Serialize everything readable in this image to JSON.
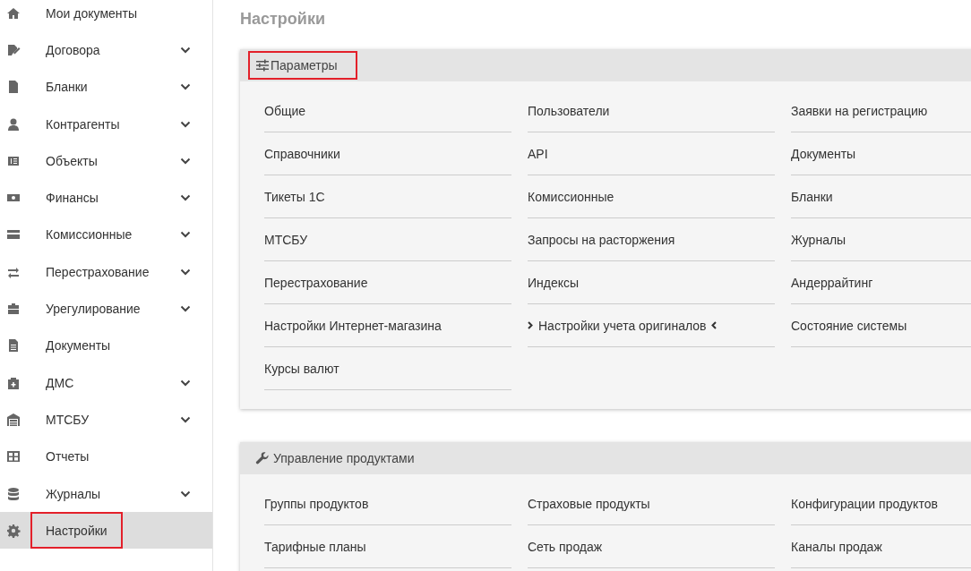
{
  "sidebar": {
    "items": [
      {
        "label": "Мои документы",
        "expandable": false,
        "selected": false,
        "highlighted": false
      },
      {
        "label": "Договора",
        "expandable": true,
        "selected": false,
        "highlighted": false
      },
      {
        "label": "Бланки",
        "expandable": true,
        "selected": false,
        "highlighted": false
      },
      {
        "label": "Контрагенты",
        "expandable": true,
        "selected": false,
        "highlighted": false
      },
      {
        "label": "Объекты",
        "expandable": true,
        "selected": false,
        "highlighted": false
      },
      {
        "label": "Финансы",
        "expandable": true,
        "selected": false,
        "highlighted": false
      },
      {
        "label": "Комиссионные",
        "expandable": true,
        "selected": false,
        "highlighted": false
      },
      {
        "label": "Перестрахование",
        "expandable": true,
        "selected": false,
        "highlighted": false
      },
      {
        "label": "Урегулирование",
        "expandable": true,
        "selected": false,
        "highlighted": false
      },
      {
        "label": "Документы",
        "expandable": false,
        "selected": false,
        "highlighted": false
      },
      {
        "label": "ДМС",
        "expandable": true,
        "selected": false,
        "highlighted": false
      },
      {
        "label": "МТСБУ",
        "expandable": true,
        "selected": false,
        "highlighted": false
      },
      {
        "label": "Отчеты",
        "expandable": false,
        "selected": false,
        "highlighted": false
      },
      {
        "label": "Журналы",
        "expandable": true,
        "selected": false,
        "highlighted": false
      },
      {
        "label": "Настройки",
        "expandable": false,
        "selected": true,
        "highlighted": true
      }
    ]
  },
  "page_title": "Настройки",
  "cards": [
    {
      "title": "Параметры",
      "highlighted": true,
      "links": [
        {
          "label": "Общие",
          "hovered": false
        },
        {
          "label": "Пользователи",
          "hovered": false
        },
        {
          "label": "Заявки на регистрацию",
          "hovered": false
        },
        {
          "label": "Справочники",
          "hovered": false
        },
        {
          "label": "API",
          "hovered": false
        },
        {
          "label": "Документы",
          "hovered": false
        },
        {
          "label": "Тикеты 1С",
          "hovered": false
        },
        {
          "label": "Комиссионные",
          "hovered": false
        },
        {
          "label": "Бланки",
          "hovered": false
        },
        {
          "label": "МТСБУ",
          "hovered": false
        },
        {
          "label": "Запросы на расторжения",
          "hovered": false
        },
        {
          "label": "Журналы",
          "hovered": false
        },
        {
          "label": "Перестрахование",
          "hovered": false
        },
        {
          "label": "Индексы",
          "hovered": false
        },
        {
          "label": "Андеррайтинг",
          "hovered": false
        },
        {
          "label": "Настройки Интернет-магазина",
          "hovered": false
        },
        {
          "label": "Настройки учета оригиналов",
          "hovered": true
        },
        {
          "label": "Состояние системы",
          "hovered": false
        },
        {
          "label": "Курсы валют",
          "hovered": false
        }
      ]
    },
    {
      "title": "Управление продуктами",
      "highlighted": false,
      "links": [
        {
          "label": "Группы продуктов",
          "hovered": false
        },
        {
          "label": "Страховые продукты",
          "hovered": false
        },
        {
          "label": "Конфигурации продуктов",
          "hovered": false
        },
        {
          "label": "Тарифные планы",
          "hovered": false
        },
        {
          "label": "Сеть продаж",
          "hovered": false
        },
        {
          "label": "Каналы продаж",
          "hovered": false
        }
      ]
    }
  ]
}
